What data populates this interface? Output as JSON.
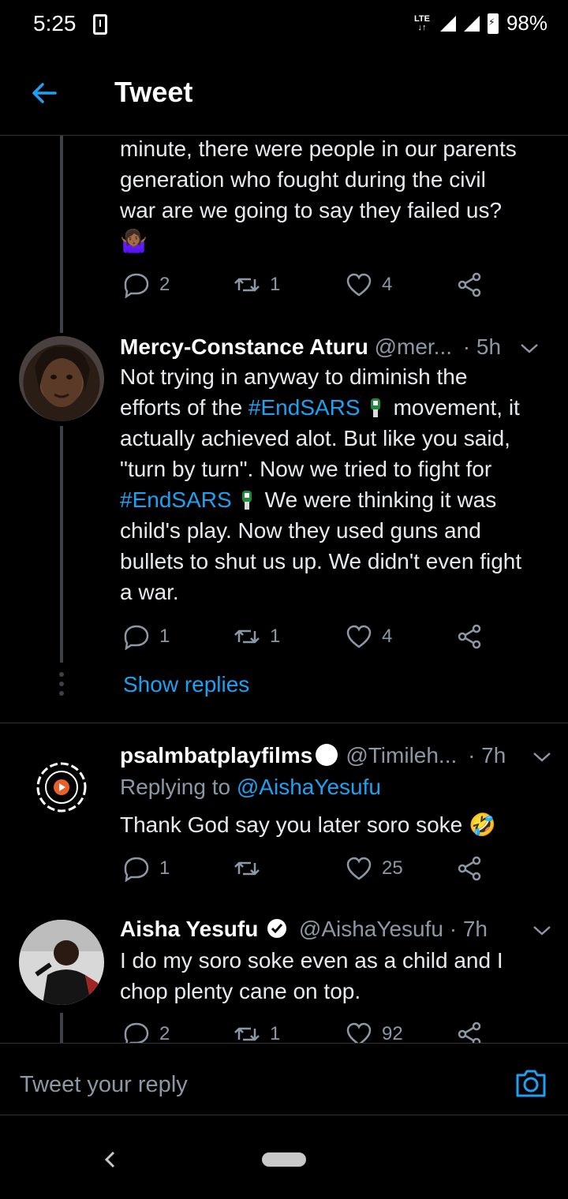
{
  "status_bar": {
    "time": "5:25",
    "network": "LTE",
    "battery": "98%"
  },
  "header": {
    "title": "Tweet"
  },
  "tweet0": {
    "lines": [
      "minute, there were people in our parents",
      "generation who fought during the civil",
      "war are we going to say they failed us?"
    ],
    "emoji": "🤷🏾‍♀️",
    "replies": "2",
    "retweets": "1",
    "likes": "4"
  },
  "tweet1": {
    "name": "Mercy-Constance Aturu",
    "handle": "@mer...",
    "time": "· 5h",
    "line1": "Not trying in anyway to diminish the",
    "line2_pre": "efforts of the ",
    "hashtag": "#EndSARS",
    "line2_post": "movement, it",
    "line3": "actually achieved alot. But like you said,",
    "line4": "\"turn by turn\". Now we tried to fight for",
    "line5_post": "We were thinking it was",
    "line6": "child's play. Now they used guns and",
    "line7": "bullets to shut us up. We didn't even fight",
    "line8": "a war.",
    "replies": "1",
    "retweets": "1",
    "likes": "4"
  },
  "show_replies": "Show replies",
  "tweet2": {
    "name": "psalmbatplayfilms",
    "handle": "@Timileh...",
    "time": "· 7h",
    "replying_prefix": "Replying to ",
    "replying_handle": "@AishaYesufu",
    "text": "Thank God say you later soro soke",
    "emoji": "🤣",
    "replies": "1",
    "retweets": "",
    "likes": "25"
  },
  "tweet3": {
    "name": "Aisha Yesufu",
    "handle": "@AishaYesufu",
    "time": "· 7h",
    "line1": "I do my soro soke even as a child and I",
    "line2": "chop plenty cane on top.",
    "replies": "2",
    "retweets": "1",
    "likes": "92"
  },
  "reply_bar": {
    "placeholder": "Tweet your reply"
  },
  "colors": {
    "accent": "#1da1f2",
    "muted": "#8b98a5",
    "background": "#000000"
  }
}
